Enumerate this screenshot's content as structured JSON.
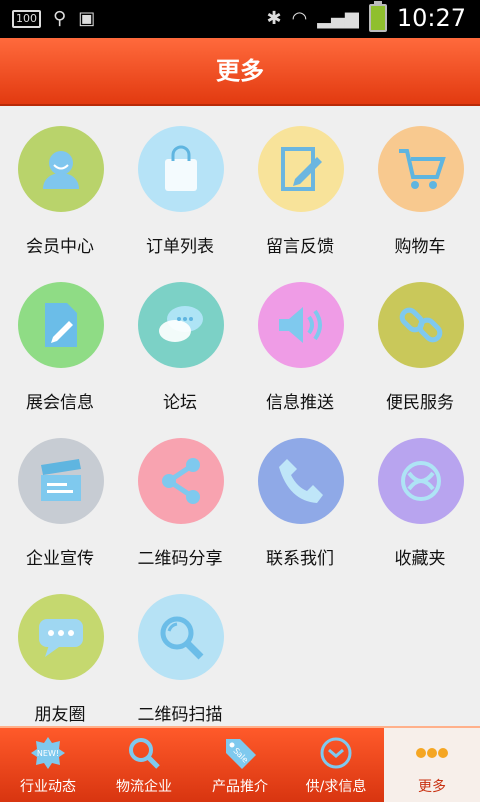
{
  "status_bar": {
    "time": "10:27",
    "badge": "100"
  },
  "header": {
    "title": "更多"
  },
  "grid_items": [
    {
      "label": "会员中心",
      "color": "#b9d36b",
      "icon": "user-icon"
    },
    {
      "label": "订单列表",
      "color": "#b6e3f7",
      "icon": "shopping-bag-icon"
    },
    {
      "label": "留言反馈",
      "color": "#f8e39a",
      "icon": "edit-icon"
    },
    {
      "label": "购物车",
      "color": "#f8c98f",
      "icon": "cart-icon"
    },
    {
      "label": "展会信息",
      "color": "#8fdc85",
      "icon": "document-icon"
    },
    {
      "label": "论坛",
      "color": "#7cd1c6",
      "icon": "chat-icon"
    },
    {
      "label": "信息推送",
      "color": "#ef9ce6",
      "icon": "speaker-icon"
    },
    {
      "label": "便民服务",
      "color": "#c9c85a",
      "icon": "link-icon"
    },
    {
      "label": "企业宣传",
      "color": "#c7ccd3",
      "icon": "clapperboard-icon"
    },
    {
      "label": "二维码分享",
      "color": "#f8a3b0",
      "icon": "share-icon"
    },
    {
      "label": "联系我们",
      "color": "#8fa9e7",
      "icon": "phone-icon"
    },
    {
      "label": "收藏夹",
      "color": "#b8a4ef",
      "icon": "ribbon-icon"
    },
    {
      "label": "朋友圈",
      "color": "#c5d86f",
      "icon": "message-icon"
    },
    {
      "label": "二维码扫描",
      "color": "#b6e2f5",
      "icon": "magnifier-icon"
    }
  ],
  "tab_bar": [
    {
      "label": "行业动态",
      "icon": "new-badge-icon"
    },
    {
      "label": "物流企业",
      "icon": "search-icon"
    },
    {
      "label": "产品推介",
      "icon": "sale-tag-icon"
    },
    {
      "label": "供/求信息",
      "icon": "clock-icon"
    },
    {
      "label": "更多",
      "icon": "more-dots-icon",
      "active": true
    }
  ],
  "tab_new_text": "NEW!",
  "tab_sale_text": "Sale"
}
